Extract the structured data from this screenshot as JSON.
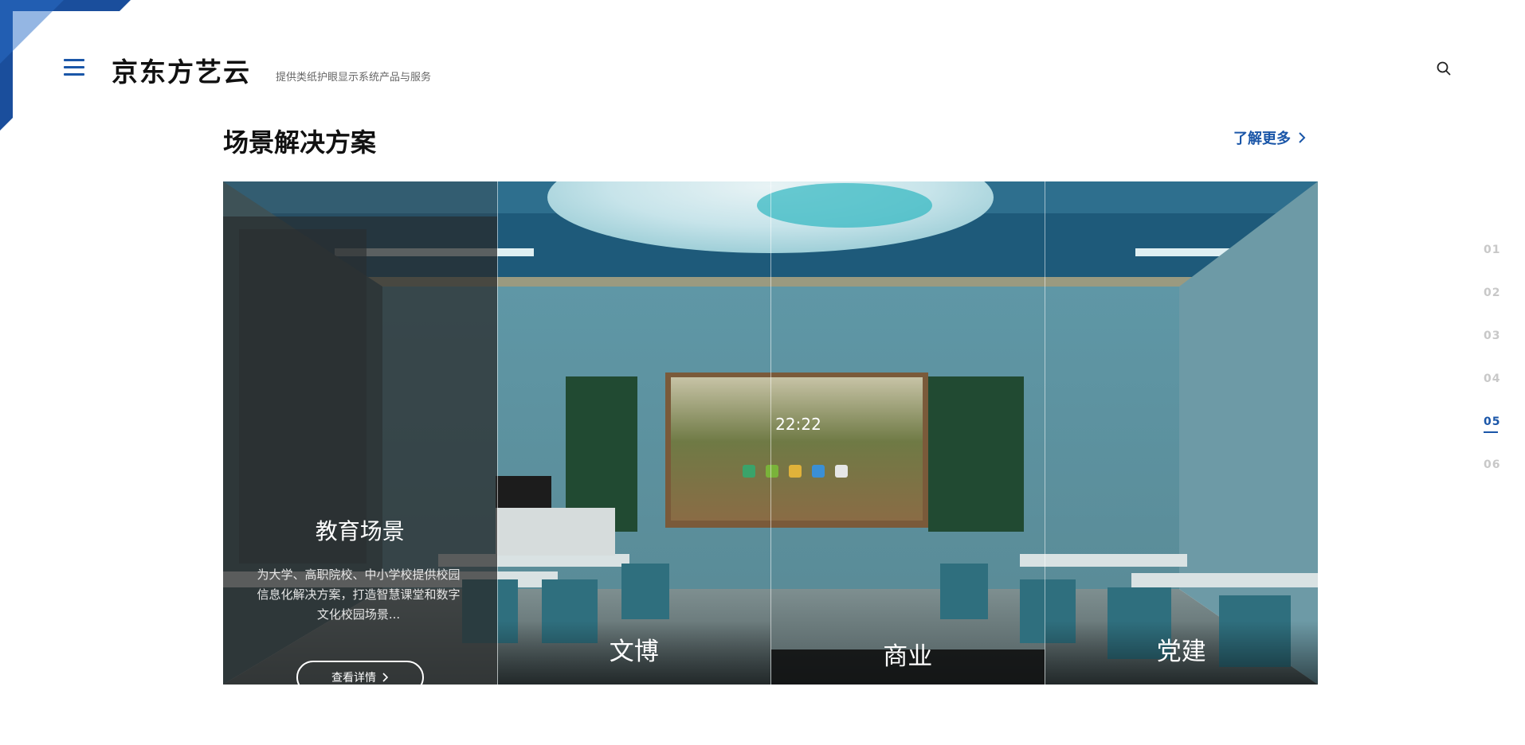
{
  "header": {
    "logo_text": "京东方艺云",
    "tagline": "提供类纸护眼显示系统产品与服务",
    "menu_icon": "hamburger-icon",
    "search_icon": "search-icon"
  },
  "section": {
    "title": "场景解决方案",
    "more_label": "了解更多"
  },
  "scenes": {
    "active": {
      "title": "教育场景",
      "description": "为大学、高职院校、中小学校提供校园信息化解决方案，打造智慧课堂和数字文化校园场景...",
      "button_label": "查看详情"
    },
    "tabs": [
      {
        "label": "文博"
      },
      {
        "label": "商业"
      },
      {
        "label": "党建"
      }
    ]
  },
  "screen_display": {
    "time": "22:22"
  },
  "pager": {
    "items": [
      "01",
      "02",
      "03",
      "04",
      "05",
      "06"
    ],
    "active_index": 4
  },
  "colors": {
    "brand_blue": "#1a56a8",
    "pager_inactive": "#c8c8c8"
  }
}
